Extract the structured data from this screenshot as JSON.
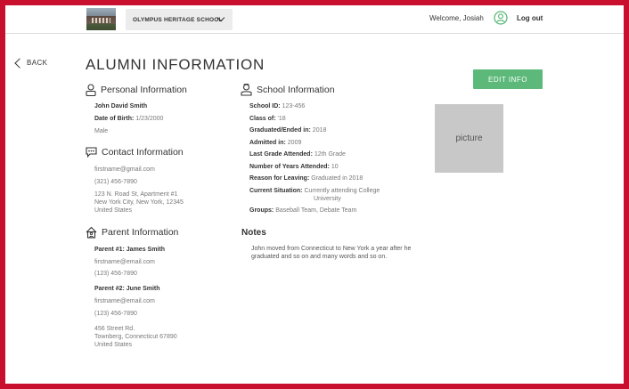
{
  "header": {
    "school_name": "OLYMPUS HERITAGE SCHOOL",
    "welcome": "Welcome, Josiah",
    "logout": "Log out"
  },
  "nav": {
    "back": "BACK"
  },
  "page": {
    "title": "ALUMNI INFORMATION",
    "edit_button": "EDIT INFO",
    "picture_placeholder": "picture"
  },
  "personal": {
    "heading": "Personal Information",
    "name": "John David Smith",
    "dob_label": "Date of Birth:",
    "dob_value": "1/23/2000",
    "gender": "Male"
  },
  "contact": {
    "heading": "Contact Information",
    "email": "firstname@gmail.com",
    "phone": "(321) 456-7890",
    "address_line1": "123 N. Road St, Apartment #1",
    "address_line2": "New York City, New York, 12345",
    "address_line3": "United States"
  },
  "parent": {
    "heading": "Parent Information",
    "p1_name": "Parent #1: James Smith",
    "p1_email": "firstname@email.com",
    "p1_phone": "(123) 456-7890",
    "p2_name": "Parent #2: June Smith",
    "p2_email": "firstname@email.com",
    "p2_phone": "(123) 456-7890",
    "address_line1": "456 Street Rd.",
    "address_line2": "Townberg, Connecticut 67890",
    "address_line3": "United States"
  },
  "school": {
    "heading": "School Information",
    "rows": [
      {
        "label": "School ID:",
        "value": "123-456"
      },
      {
        "label": "Class of:",
        "value": "'18"
      },
      {
        "label": "Graduated/Ended in:",
        "value": "2018"
      },
      {
        "label": "Admitted in:",
        "value": "2009"
      },
      {
        "label": "Last Grade Attended:",
        "value": "12th Grade"
      },
      {
        "label": "Number of Years Attended:",
        "value": "10"
      },
      {
        "label": "Reason for Leaving:",
        "value": "Graduated in 2018"
      },
      {
        "label": "Current Situation:",
        "value": "Currently attending College",
        "value2": "University"
      },
      {
        "label": "Groups:",
        "value": "Baseball Team, Debate Team"
      }
    ]
  },
  "notes": {
    "heading": "Notes",
    "text": "John moved from Connecticut to New York a year after he graduated and so on and many words and so on."
  },
  "colors": {
    "accent": "#5cb97a",
    "border": "#c8102e"
  }
}
